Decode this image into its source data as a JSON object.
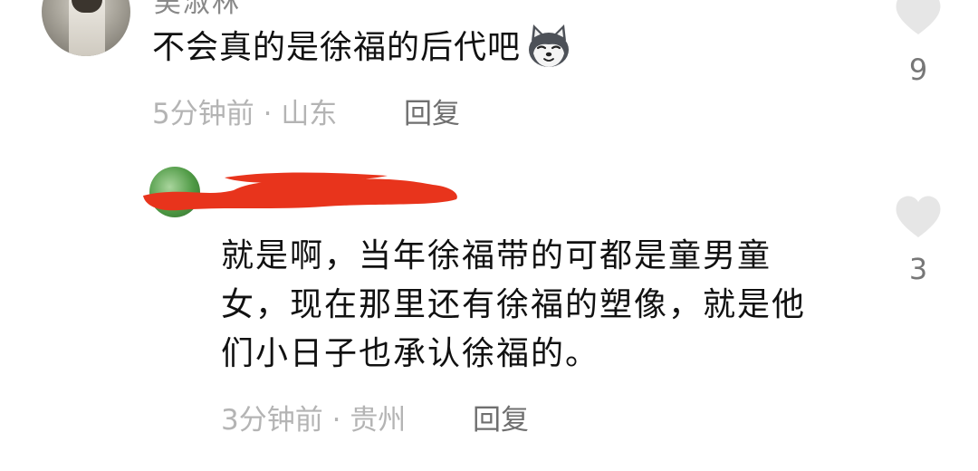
{
  "comments": [
    {
      "username": "吴淑林",
      "text": "不会真的是徐福的后代吧",
      "emoji": "husky-dog-emoji",
      "time": "5分钟前",
      "separator": "·",
      "location": "山东",
      "reply_label": "回复",
      "likes": "9"
    },
    {
      "username_redacted": true,
      "text_lines": [
        "就是啊，当年徐福带的可都是童男童",
        "女，现在那里还有徐福的塑像，就是他",
        "们小日子也承认徐福的。"
      ],
      "time": "3分钟前",
      "separator": "·",
      "location": "贵州",
      "reply_label": "回复",
      "likes": "3"
    }
  ],
  "colors": {
    "text_primary": "#111111",
    "text_meta": "#b4b4b4",
    "reply_text": "#6f6f6f",
    "heart_icon": "#e6e6e6",
    "redaction": "#e8341c"
  }
}
